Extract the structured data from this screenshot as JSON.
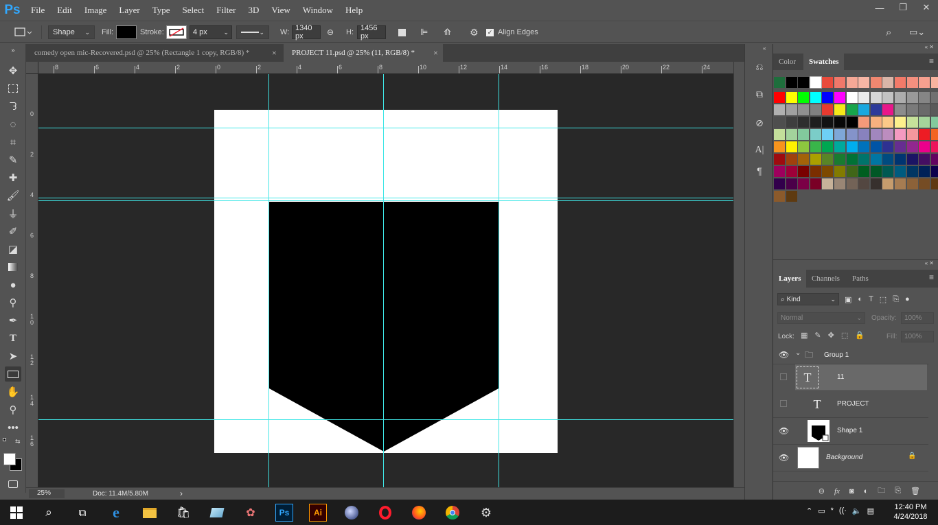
{
  "app": {
    "logo": "Ps"
  },
  "menu": [
    "File",
    "Edit",
    "Image",
    "Layer",
    "Type",
    "Select",
    "Filter",
    "3D",
    "View",
    "Window",
    "Help"
  ],
  "window_controls": {
    "minimize": "—",
    "restore": "❐",
    "close": "✕"
  },
  "options": {
    "mode": "Shape",
    "fill_label": "Fill:",
    "stroke_label": "Stroke:",
    "stroke_width": "4 px",
    "w_label": "W:",
    "w_value": "1340 px",
    "h_label": "H:",
    "h_value": "1456 px",
    "align_edges": "Align Edges"
  },
  "tabs": [
    {
      "title": "comedy open mic-Recovered.psd @ 25% (Rectangle 1 copy, RGB/8) *",
      "close": "×",
      "active": false
    },
    {
      "title": "PROJECT 11.psd @ 25% (11, RGB/8) *",
      "close": "×",
      "active": true
    }
  ],
  "ruler_h": [
    "8",
    "6",
    "4",
    "2",
    "0",
    "2",
    "4",
    "6",
    "8",
    "10",
    "12",
    "14",
    "16",
    "18",
    "20",
    "22",
    "24"
  ],
  "ruler_v": [
    "0",
    "2",
    "4",
    "6",
    "8",
    "1\n0",
    "1\n2",
    "1\n4",
    "1\n6"
  ],
  "status": {
    "zoom": "25%",
    "doc": "Doc: 11.4M/5.80M",
    "arrow": "›"
  },
  "color_panel": {
    "tab_color": "Color",
    "tab_swatches": "Swatches"
  },
  "layers_panel": {
    "tab_layers": "Layers",
    "tab_channels": "Channels",
    "tab_paths": "Paths",
    "kind": "Kind",
    "blend": "Normal",
    "opacity_label": "Opacity:",
    "opacity_value": "100%",
    "lock_label": "Lock:",
    "fill_label": "Fill:",
    "fill_value": "100%",
    "layers": [
      {
        "name": "Group 1",
        "type": "group"
      },
      {
        "name": "11",
        "type": "text"
      },
      {
        "name": "PROJECT",
        "type": "text"
      },
      {
        "name": "Shape 1",
        "type": "shape"
      },
      {
        "name": "Background",
        "type": "background"
      }
    ]
  },
  "taskbar": {
    "time": "12:40 PM",
    "date": "4/24/2018"
  },
  "colors": {
    "accent": "#31a8ff",
    "guide": "#3fe6e6",
    "canvas_bg": "#282828"
  }
}
